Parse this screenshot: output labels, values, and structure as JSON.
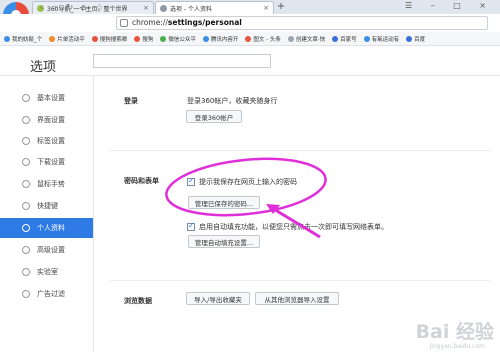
{
  "browser": {
    "tabs": [
      {
        "label": "360导航_一个主页，整个世界"
      },
      {
        "label": "选项 - 个人资料"
      }
    ],
    "new_tab_label": "+",
    "window_controls": "☰ – □ ×",
    "address": {
      "prefix": "chrome://",
      "bold": "settings/personal",
      "suffix": ""
    },
    "nav_icons": [
      "back-icon",
      "forward-icon",
      "refresh-icon",
      "home-icon",
      "favorite-icon"
    ],
    "bookmarks": [
      {
        "label": "我的妨鬆_个",
        "color": "#3a8ee6"
      },
      {
        "label": "片单活动平",
        "color": "#ef8b2c"
      },
      {
        "label": "搜狗搜索卿",
        "color": "#e8533d"
      },
      {
        "label": "搜狗",
        "color": "#e8533d"
      },
      {
        "label": "微信公众平",
        "color": "#4cae4c"
      },
      {
        "label": "腾讯内容开",
        "color": "#3a8ee6"
      },
      {
        "label": "图文 - 头条",
        "color": "#e8533d"
      },
      {
        "label": "创建文章·快",
        "color": "#9aa5b1"
      },
      {
        "label": "百家号",
        "color": "#3a6fd8"
      },
      {
        "label": "有氧运动有",
        "color": "#3a8ee6"
      },
      {
        "label": "百度",
        "color": "#3a6fd8"
      }
    ]
  },
  "page": {
    "title": "选项",
    "search_placeholder": ""
  },
  "sidebar": {
    "items": [
      {
        "label": "基本设置",
        "icon": "gear-icon",
        "active": false
      },
      {
        "label": "界面设置",
        "icon": "layout-icon",
        "active": false
      },
      {
        "label": "标签设置",
        "icon": "tab-icon",
        "active": false
      },
      {
        "label": "下载设置",
        "icon": "download-icon",
        "active": false
      },
      {
        "label": "鼠标手势",
        "icon": "mouse-icon",
        "active": false
      },
      {
        "label": "快捷键",
        "icon": "keyboard-icon",
        "active": false
      },
      {
        "label": "个人资料",
        "icon": "user-icon",
        "active": true
      },
      {
        "label": "高级设置",
        "icon": "advanced-icon",
        "active": false
      },
      {
        "label": "实验室",
        "icon": "lab-icon",
        "active": false
      },
      {
        "label": "广告过滤",
        "icon": "block-icon",
        "active": false
      }
    ]
  },
  "login": {
    "title": "登录",
    "desc": "登录360帐户，收藏夹随身行",
    "button": "登录360帐户"
  },
  "passwords": {
    "title": "密码和表单",
    "save_prompt": "提示我保存在网页上输入的密码",
    "manage_button": "管理已保存的密码...",
    "autofill": "启用自动填充功能，以便您只需点击一次即可填写网络表单。",
    "autofill_button": "管理自动填充设置..."
  },
  "browsing": {
    "title": "浏览数据",
    "import_export": "导入/导出收藏夹",
    "import_other": "从其他浏览器导入设置"
  },
  "annotation": {
    "color": "#e02fd8"
  },
  "watermark": {
    "main": "Bai 经验",
    "sub": "jingyan.baidu.com"
  }
}
